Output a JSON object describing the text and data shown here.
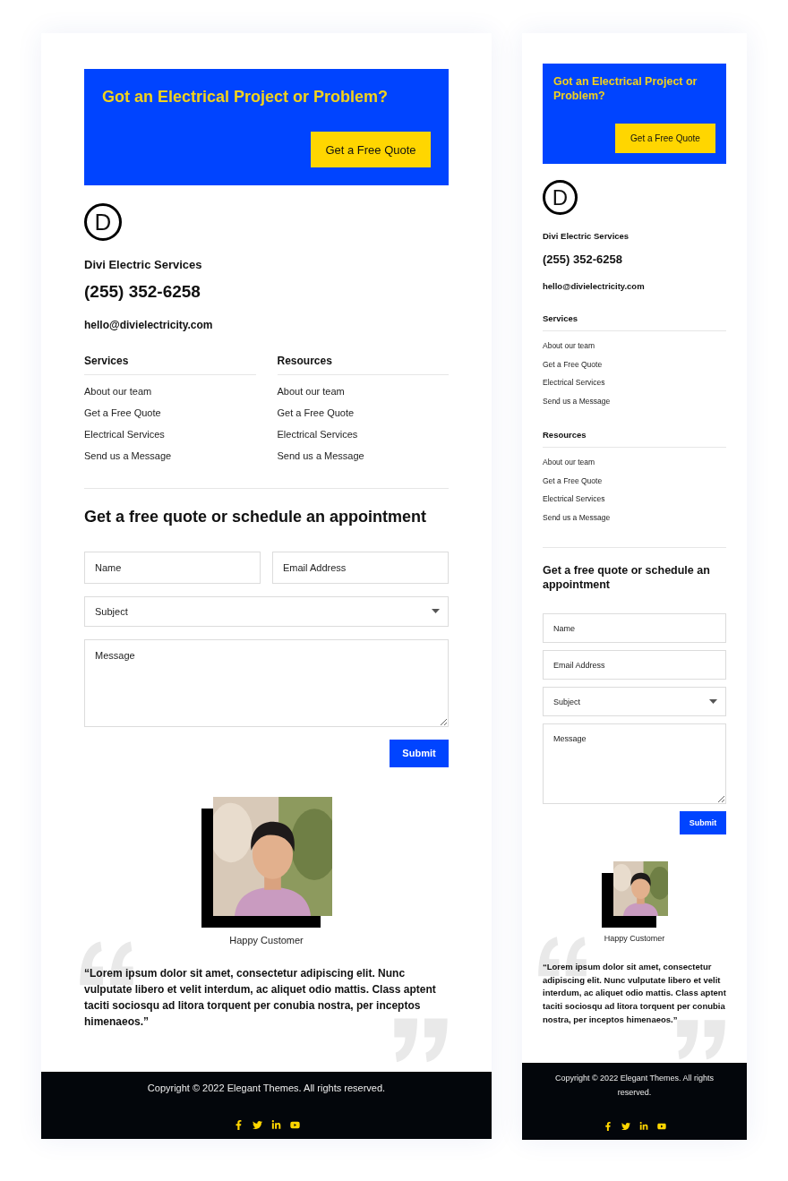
{
  "previews": [
    {
      "kind": "desktop",
      "banner": {
        "headline": "Got an Electrical Project or Problem?",
        "button": "Get a Free Quote"
      },
      "logo_letter": "D",
      "company": "Divi Electric Services",
      "phone": "(255) 352-6258",
      "email": "hello@divielectricity.com",
      "link_groups": [
        {
          "title": "Services",
          "links": [
            "About our team",
            "Get a Free Quote",
            "Electrical Services",
            "Send us a Message"
          ]
        },
        {
          "title": "Resources",
          "links": [
            "About our team",
            "Get a Free Quote",
            "Electrical Services",
            "Send us a Message"
          ]
        }
      ],
      "form": {
        "heading": "Get a free quote or schedule an appointment",
        "fields": [
          {
            "kind": "text",
            "placeholder": "Name"
          },
          {
            "kind": "text",
            "placeholder": "Email Address"
          },
          {
            "kind": "select",
            "placeholder": "Subject"
          },
          {
            "kind": "textarea",
            "placeholder": "Message"
          }
        ],
        "submit": "Submit"
      },
      "testimonial": {
        "caption": "Happy Customer",
        "quote": "“Lorem ipsum dolor sit amet, consectetur adipiscing elit. Nunc vulputate libero et velit interdum, ac aliquet odio mattis. Class aptent taciti sociosqu ad litora torquent per conubia nostra, per inceptos himenaeos.”"
      },
      "footer": {
        "copyright": "Copyright © 2022 Elegant Themes. All rights reserved.",
        "social": [
          {
            "kind": "facebook"
          },
          {
            "kind": "twitter"
          },
          {
            "kind": "linkedin"
          },
          {
            "kind": "youtube"
          }
        ]
      }
    },
    {
      "kind": "mobile",
      "banner": {
        "headline": "Got an Electrical Project or Problem?",
        "button": "Get a Free Quote"
      },
      "logo_letter": "D",
      "company": "Divi Electric Services",
      "phone": "(255) 352-6258",
      "email": "hello@divielectricity.com",
      "link_groups": [
        {
          "title": "Services",
          "links": [
            "About our team",
            "Get a Free Quote",
            "Electrical Services",
            "Send us a Message"
          ]
        },
        {
          "title": "Resources",
          "links": [
            "About our team",
            "Get a Free Quote",
            "Electrical Services",
            "Send us a Message"
          ]
        }
      ],
      "form": {
        "heading": "Get a free quote or schedule an appointment",
        "fields": [
          {
            "kind": "text",
            "placeholder": "Name"
          },
          {
            "kind": "text",
            "placeholder": "Email Address"
          },
          {
            "kind": "select",
            "placeholder": "Subject"
          },
          {
            "kind": "textarea",
            "placeholder": "Message"
          }
        ],
        "submit": "Submit"
      },
      "testimonial": {
        "caption": "Happy Customer",
        "quote": "“Lorem ipsum dolor sit amet, consectetur adipiscing elit. Nunc vulputate libero et velit interdum, ac aliquet odio mattis. Class aptent taciti sociosqu ad litora torquent per conubia nostra, per inceptos himenaeos.”"
      },
      "footer": {
        "copyright": "Copyright © 2022 Elegant Themes. All rights reserved.",
        "social": [
          {
            "kind": "facebook"
          },
          {
            "kind": "twitter"
          },
          {
            "kind": "linkedin"
          },
          {
            "kind": "youtube"
          }
        ]
      }
    }
  ]
}
